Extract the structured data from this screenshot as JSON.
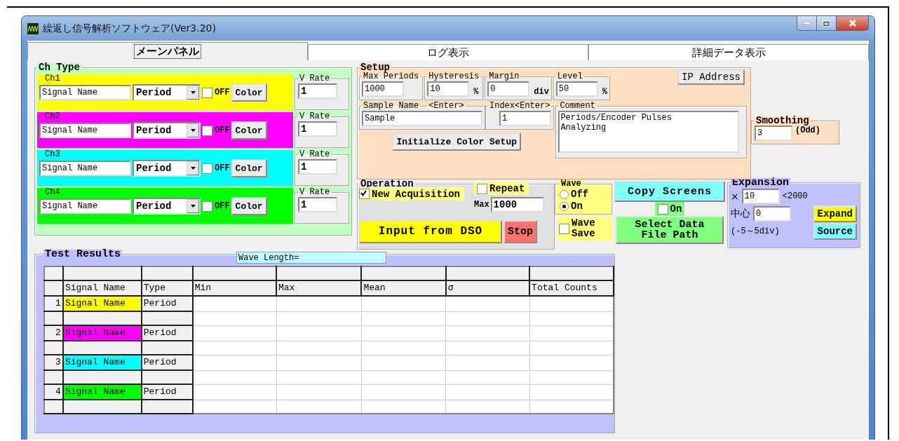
{
  "window": {
    "title": "繰返し信号解析ソフトウェア(Ver3.20)"
  },
  "tabs": [
    {
      "label": "メーンパネル",
      "selected": true
    },
    {
      "label": "ログ表示",
      "selected": false
    },
    {
      "label": "詳細データ表示",
      "selected": false
    }
  ],
  "ch_type": {
    "title": "Ch Type",
    "channels": [
      {
        "label": "Ch1",
        "color": "#ffff00",
        "signal_name": "Signal Name",
        "type": "Period",
        "off_label": "OFF",
        "off_checked": false,
        "color_button": "Color",
        "v_rate_label": "V Rate",
        "v_rate": "1"
      },
      {
        "label": "Ch2",
        "color": "#ff00ff",
        "signal_name": "Signal Name",
        "type": "Period",
        "off_label": "OFF",
        "off_checked": false,
        "color_button": "Color",
        "v_rate_label": "V Rate",
        "v_rate": "1"
      },
      {
        "label": "Ch3",
        "color": "#00ffff",
        "signal_name": "Signal Name",
        "type": "Period",
        "off_label": "OFF",
        "off_checked": false,
        "color_button": "Color",
        "v_rate_label": "V Rate",
        "v_rate": "1"
      },
      {
        "label": "Ch4",
        "color": "#00ff00",
        "signal_name": "Signal Name",
        "type": "Period",
        "off_label": "OFF",
        "off_checked": false,
        "color_button": "Color",
        "v_rate_label": "V Rate",
        "v_rate": "1"
      }
    ]
  },
  "setup": {
    "title": "Setup",
    "ip_button": "IP Address",
    "fields": [
      {
        "label": "Max Periods",
        "value": "1000"
      },
      {
        "label": "Hysteresis",
        "value": "10",
        "unit": "%"
      },
      {
        "label": "Margin",
        "value": "0",
        "unit": "div"
      },
      {
        "label": "Level",
        "value": "50",
        "unit": "%"
      }
    ],
    "sample_name": {
      "label": "Sample Name",
      "hint": "<Enter>",
      "value": "Sample"
    },
    "index": {
      "label": "Index<Enter>",
      "value": "1"
    },
    "comment": {
      "label": "Comment",
      "value": "Periods/Encoder Pulses\nAnalyzing"
    },
    "init_button": "Initialize Color Setup"
  },
  "smoothing": {
    "title": "Smoothing",
    "value": "3",
    "note": "(Odd)"
  },
  "operation": {
    "title": "Operation",
    "new_acquisition": {
      "label": "New Acquisition",
      "checked": true
    },
    "repeat": {
      "label": "Repeat",
      "checked": false
    },
    "max_label": "Max",
    "max_value": "1000",
    "input_button": "Input from DSO",
    "stop_button": "Stop"
  },
  "wave": {
    "title": "Wave",
    "options": [
      {
        "label": "Off",
        "selected": false
      },
      {
        "label": "On",
        "selected": true
      }
    ],
    "save": {
      "label": "Wave Save",
      "checked": false
    }
  },
  "copy_screens": {
    "button": "Copy Screens",
    "on": {
      "label": "On",
      "checked": false
    },
    "select_button": "Select Data File Path"
  },
  "expansion": {
    "title": "Expansion",
    "times_label": "×",
    "times_value": "10",
    "limit": "<2000",
    "center_label": "中心",
    "center_value": "0",
    "range": "(-5～5div)",
    "expand_button": "Expand",
    "source_button": "Source"
  },
  "test_results": {
    "title": "Test Results",
    "wave_length": "Wave Length=",
    "columns": [
      "Signal Name",
      "Type",
      "Min",
      "Max",
      "Mean",
      "σ",
      "Total Counts"
    ],
    "rows": [
      {
        "index": "1",
        "signal_name": "Signal Name",
        "color": "#ffff00",
        "type": "Period"
      },
      {
        "index": "2",
        "signal_name": "Signal Name",
        "color": "#ff00ff",
        "type": "Period"
      },
      {
        "index": "3",
        "signal_name": "Signal Name",
        "color": "#00ffff",
        "type": "Period"
      },
      {
        "index": "4",
        "signal_name": "Signal Name",
        "color": "#00ff00",
        "type": "Period"
      }
    ]
  }
}
